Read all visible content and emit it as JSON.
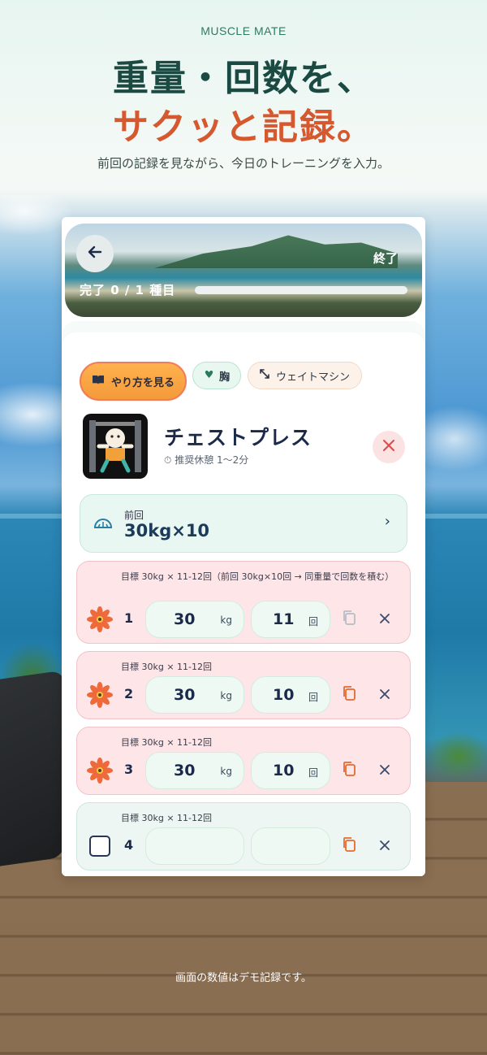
{
  "hero": {
    "brand": "MUSCLE MATE",
    "headline_line1": "重量・回数を、",
    "headline_line2": "サクッと記録。",
    "subtitle": "前回の記録を見ながら、今日のトレーニングを入力。"
  },
  "app": {
    "header": {
      "back_icon": "arrow-left-icon",
      "end_label": "終了",
      "progress_label": "完了 0 / 1 種目",
      "progress_fraction": 0.0
    },
    "chips": {
      "howto_label": "やり方を見る",
      "bodypart_label": "胸",
      "equipment_label": "ウェイトマシン"
    },
    "exercise": {
      "name": "チェストプレス",
      "rest": "推奨休憩 1〜2分"
    },
    "previous": {
      "label": "前回",
      "value": "30kg×10"
    },
    "sets": [
      {
        "number": "1",
        "target": "目標 30kg × 11-12回（前回 30kg×10回 → 同重量で回数を積む）",
        "weight": "30",
        "reps": "11",
        "done": true
      },
      {
        "number": "2",
        "target": "目標 30kg × 11-12回",
        "weight": "30",
        "reps": "10",
        "done": true
      },
      {
        "number": "3",
        "target": "目標 30kg × 11-12回",
        "weight": "30",
        "reps": "10",
        "done": true
      },
      {
        "number": "4",
        "target": "目標 30kg × 11-12回",
        "weight": "",
        "reps": "",
        "done": false
      }
    ],
    "units": {
      "weight": "kg",
      "reps": "回"
    },
    "colors": {
      "accent_orange": "#d5582f",
      "done_card": "#fde5e8",
      "todo_card": "#edf6f2",
      "flower": "#ef6a3a"
    }
  },
  "footnote": "画面の数値はデモ記録です。"
}
